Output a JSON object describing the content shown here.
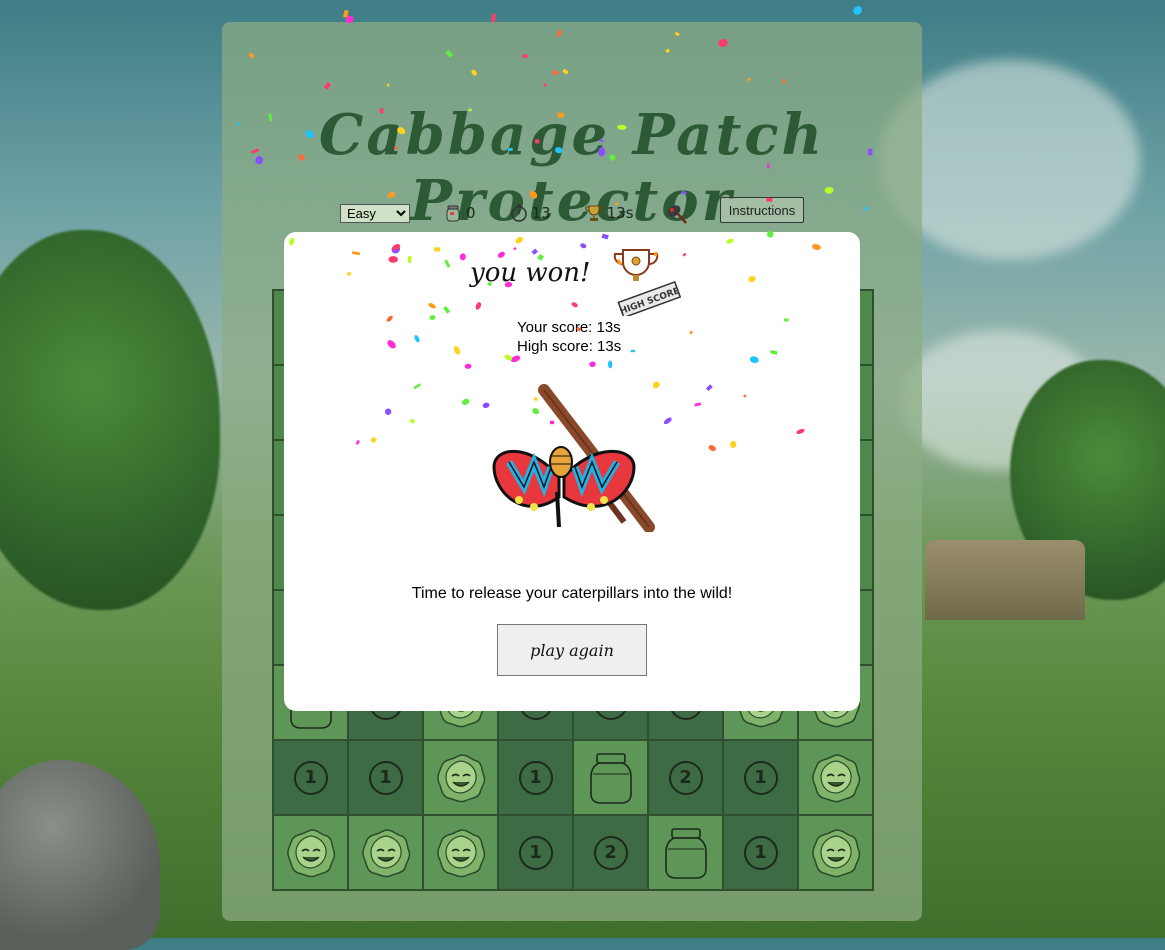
{
  "game": {
    "title": "Cabbage Patch Protector"
  },
  "toolbar": {
    "difficulty_selected": "Easy",
    "difficulty_options": [
      "Easy"
    ],
    "jar_icon": "jar-icon",
    "jar_count": "0",
    "timer_icon": "stopwatch-icon",
    "timer_value": "13",
    "trophy_icon": "trophy-icon",
    "best_time": "13s",
    "tool_icon": "net-icon",
    "instructions_label": "Instructions"
  },
  "modal": {
    "title": "you won!",
    "badge_label": "HIGH SCORE",
    "your_score_line": "Your score: 13s",
    "high_score_line": "High score: 13s",
    "message": "Time to release your caterpillars into the wild!",
    "play_again_label": "play again"
  },
  "board": {
    "rows": [
      [
        "covered",
        "covered",
        "covered",
        "covered",
        "covered",
        "covered",
        "covered",
        "covered"
      ],
      [
        "covered",
        "covered",
        "covered",
        "covered",
        "covered",
        "covered",
        "covered",
        "covered"
      ],
      [
        "covered",
        "covered",
        "covered",
        "covered",
        "covered",
        "covered",
        "covered",
        "covered"
      ],
      [
        "covered",
        "covered",
        "covered",
        "covered",
        "covered",
        "covered",
        "covered",
        "covered"
      ],
      [
        "covered",
        "covered",
        "covered",
        "covered",
        "covered",
        "covered",
        "covered",
        "covered"
      ],
      [
        "jar",
        "1",
        "cabbage",
        "1",
        "1",
        "1",
        "cabbage",
        "cabbage"
      ],
      [
        "1",
        "1",
        "cabbage",
        "1",
        "jar",
        "2",
        "1",
        "cabbage"
      ],
      [
        "cabbage",
        "cabbage",
        "cabbage",
        "1",
        "2",
        "jar",
        "1",
        "cabbage"
      ]
    ]
  },
  "colors": {
    "panel": "#8cac84",
    "title": "#2c5a34",
    "cell_dark": "#3d6b43",
    "cell_light": "#5d9656",
    "butterfly_red": "#e8383d",
    "butterfly_blue": "#1fb3e8"
  }
}
